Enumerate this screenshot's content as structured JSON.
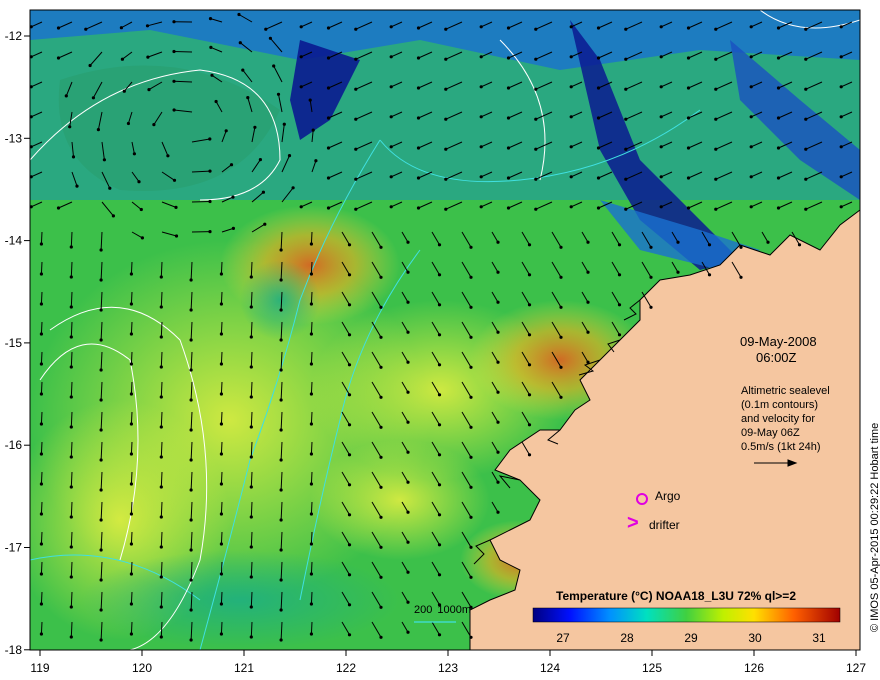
{
  "map": {
    "date": "09-May-2008",
    "time": "06:00Z",
    "altimetry_lines": [
      "Altimetric sealevel",
      "(0.1m contours)",
      "and velocity for",
      "09-May 06Z",
      "0.5m/s (1kt 24h)"
    ],
    "argo_label": "Argo",
    "drifter_label": "drifter",
    "drifter_symbol": ">",
    "contour_label": "200  1000m",
    "colorbar_title": "Temperature (°C) NOAA18_L3U 72% ql>=2",
    "colorbar_ticks": [
      "27",
      "28",
      "29",
      "30",
      "31"
    ],
    "x_ticks": [
      "119",
      "120",
      "121",
      "122",
      "123",
      "124",
      "125",
      "126",
      "127"
    ],
    "y_ticks": [
      "-12",
      "-13",
      "-14",
      "-15",
      "-16",
      "-17",
      "-18"
    ],
    "credit": "© IMOS 05-Apr-2015 00:29:22 Hobart time",
    "colors": {
      "land": "#f5c6a0",
      "coast": "#000000",
      "argo": "#e000e0",
      "drifter": "#e000e0",
      "isobath": "#40e0e0",
      "sealevel_contour": "#ffffff",
      "sst_cold": "#00008b",
      "sst_warm": "#b22222"
    }
  }
}
